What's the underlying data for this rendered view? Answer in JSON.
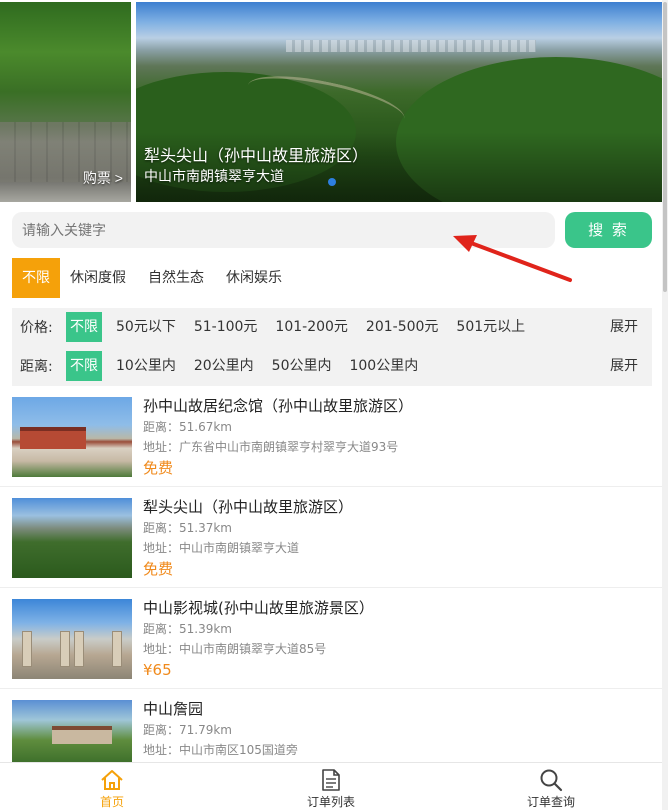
{
  "carousel": {
    "left_slide": {
      "ticket_label": "购票 >"
    },
    "main_slide": {
      "title": "犁头尖山（孙中山故里旅游区）",
      "address": "中山市南朗镇翠亨大道"
    }
  },
  "search": {
    "placeholder": "请输入关键字",
    "button_label": "搜 索"
  },
  "categories": [
    "不限",
    "休闲度假",
    "自然生态",
    "休闲娱乐"
  ],
  "filters": {
    "price": {
      "label": "价格:",
      "options": [
        "不限",
        "50元以下",
        "51-100元",
        "101-200元",
        "201-500元",
        "501元以上"
      ],
      "expand": "展开"
    },
    "distance": {
      "label": "距离:",
      "options": [
        "不限",
        "10公里内",
        "20公里内",
        "50公里内",
        "100公里内"
      ],
      "expand": "展开"
    }
  },
  "list": [
    {
      "name": "孙中山故居纪念馆（孙中山故里旅游区）",
      "distance": "距离：51.67km",
      "address": "地址：广东省中山市南朗镇翠亨村翠亨大道93号",
      "price": "免费"
    },
    {
      "name": "犁头尖山（孙中山故里旅游区）",
      "distance": "距离：51.37km",
      "address": "地址：中山市南朗镇翠亨大道",
      "price": "免费"
    },
    {
      "name": "中山影视城(孙中山故里旅游景区）",
      "distance": "距离：51.39km",
      "address": "地址：中山市南朗镇翠亨大道85号",
      "price": "¥65"
    },
    {
      "name": "中山詹园",
      "distance": "距离：71.79km",
      "address": "地址：中山市南区105国道旁",
      "price": ""
    }
  ],
  "nav": {
    "home": "首页",
    "orders": "订单列表",
    "query": "订单查询"
  },
  "colors": {
    "accent_orange": "#f5a10a",
    "accent_green": "#3ac58a",
    "price_orange": "#f08a1c",
    "arrow_red": "#e0241b"
  }
}
